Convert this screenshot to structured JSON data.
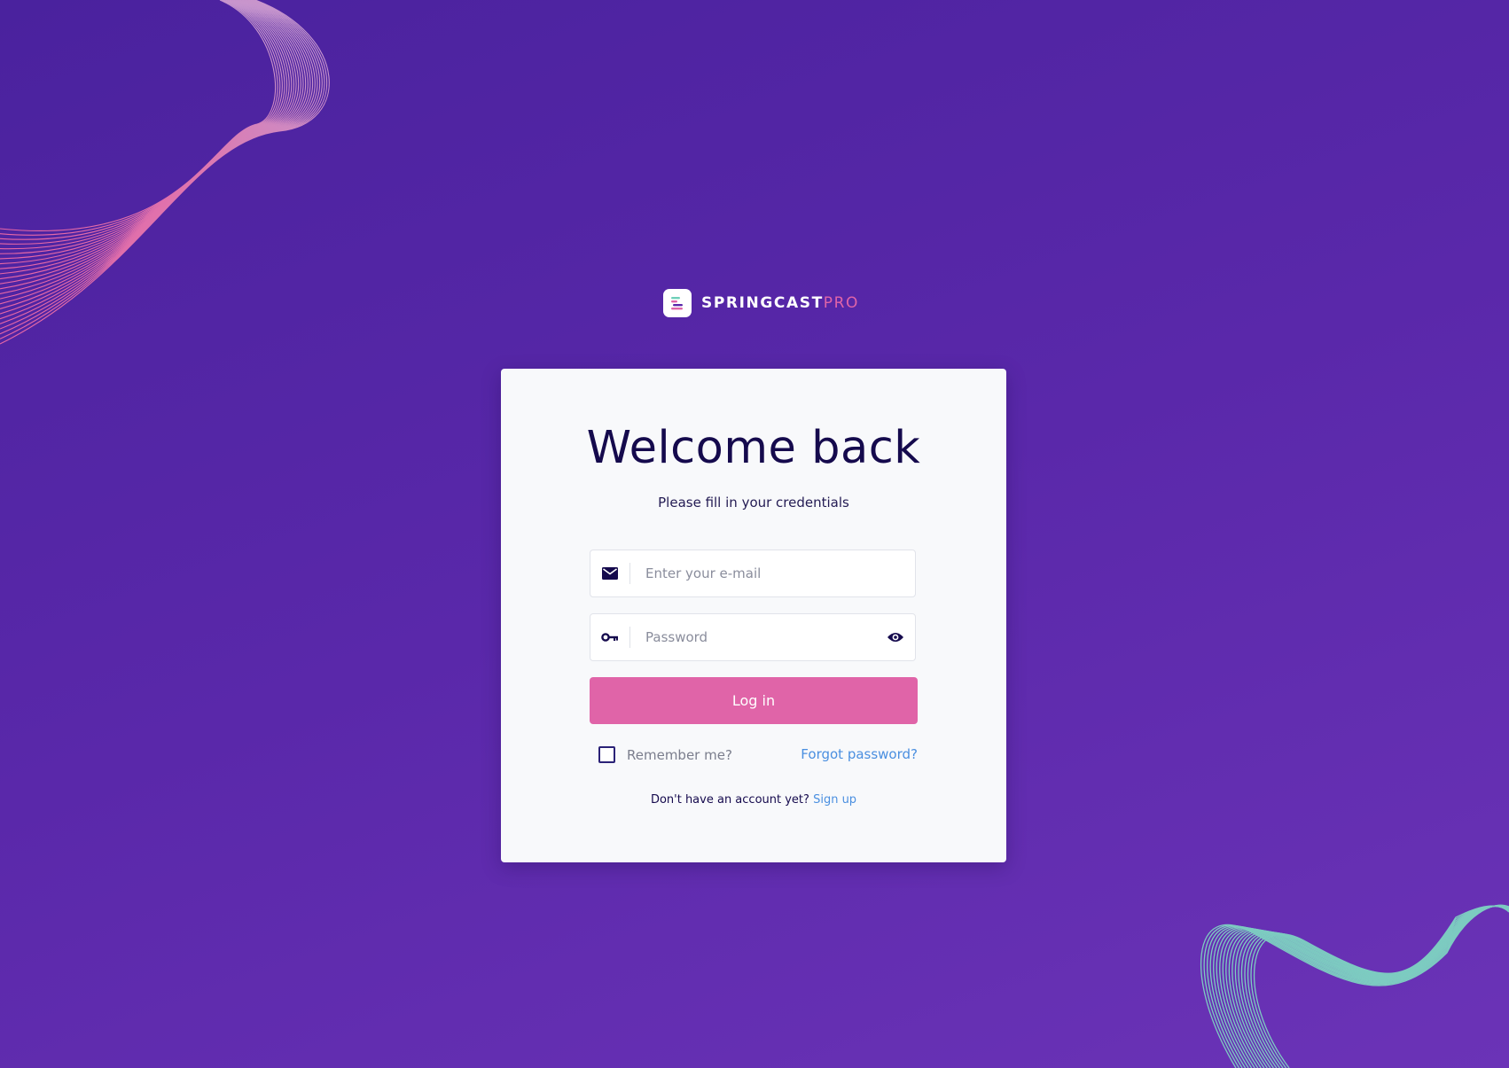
{
  "brand": {
    "name": "SPRINGCAST",
    "suffix": "PRO"
  },
  "login": {
    "title": "Welcome back",
    "subtitle": "Please fill in your credentials",
    "email": {
      "placeholder": "Enter your e-mail",
      "value": "",
      "icon": "envelope-icon"
    },
    "password": {
      "placeholder": "Password",
      "value": "",
      "icon": "key-icon",
      "toggle_icon": "eye-icon"
    },
    "submit_label": "Log in",
    "remember_label": "Remember me?",
    "remember_checked": false,
    "forgot_label": "Forgot password?",
    "signup_prompt": "Don't have an account yet?",
    "signup_label": "Sign up"
  },
  "colors": {
    "background_start": "#4a229e",
    "background_end": "#6b33b7",
    "accent_pink": "#e064a8",
    "link_blue": "#4a8fe0",
    "heading_navy": "#150a4d",
    "wave_teal": "#7fd4c2"
  }
}
